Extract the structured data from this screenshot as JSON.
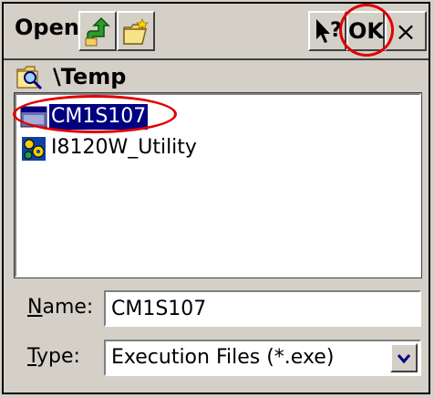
{
  "title": "Open",
  "toolbar": {
    "up_icon": "up-folder-icon",
    "new_folder_icon": "new-folder-icon",
    "help_icon": "help-pointer-icon",
    "ok_label": "OK",
    "close_label": "×"
  },
  "path": {
    "icon": "folder-search-icon",
    "text": "\\Temp"
  },
  "files": [
    {
      "name": "CM1S107",
      "icon": "exe-file-icon",
      "selected": true
    },
    {
      "name": "I8120W_Utility",
      "icon": "utility-app-icon",
      "selected": false
    }
  ],
  "fields": {
    "name_label_access": "N",
    "name_label_rest": "ame:",
    "name_value": "CM1S107",
    "type_label_access": "T",
    "type_label_rest": "ype:",
    "type_value": "Execution Files (*.exe)"
  },
  "colors": {
    "selection": "#000080",
    "annotation": "#e00000",
    "dialog_bg": "#d4d0c8"
  }
}
